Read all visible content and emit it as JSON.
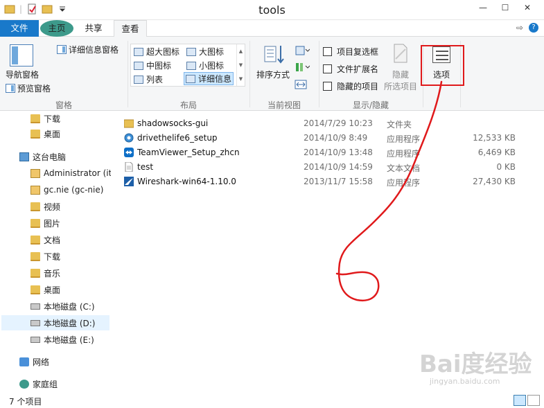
{
  "window": {
    "title": "tools"
  },
  "tabs": {
    "file": "文件",
    "home": "主页",
    "share": "共享",
    "view": "查看"
  },
  "ribbon": {
    "groups": {
      "panes": "窗格",
      "layout": "布局",
      "current_view": "当前视图",
      "show_hide": "显示/隐藏"
    },
    "nav_pane": "导航窗格",
    "preview_pane": "预览窗格",
    "details_pane": "详细信息窗格",
    "layout_items": {
      "extra_large": "超大图标",
      "large": "大图标",
      "medium": "中图标",
      "small": "小图标",
      "list": "列表",
      "details": "详细信息"
    },
    "sort_by": "排序方式",
    "item_checkboxes": "项目复选框",
    "file_extensions": "文件扩展名",
    "hidden_items": "隐藏的项目",
    "hide": "隐藏",
    "hide_selected": "所选项目",
    "options": "选项"
  },
  "navpane": {
    "items": [
      {
        "label": "下载",
        "icon": "folder-icon"
      },
      {
        "label": "桌面",
        "icon": "folder-icon"
      },
      {
        "label": "这台电脑",
        "icon": "pc-icon"
      },
      {
        "label": "Administrator (iti",
        "icon": "network-drive-icon"
      },
      {
        "label": "gc.nie (gc-nie)",
        "icon": "network-drive-icon"
      },
      {
        "label": "视频",
        "icon": "folder-icon"
      },
      {
        "label": "图片",
        "icon": "folder-icon"
      },
      {
        "label": "文档",
        "icon": "folder-icon"
      },
      {
        "label": "下载",
        "icon": "folder-icon"
      },
      {
        "label": "音乐",
        "icon": "folder-icon"
      },
      {
        "label": "桌面",
        "icon": "folder-icon"
      },
      {
        "label": "本地磁盘 (C:)",
        "icon": "drive-icon"
      },
      {
        "label": "本地磁盘 (D:)",
        "icon": "drive-icon"
      },
      {
        "label": "本地磁盘 (E:)",
        "icon": "drive-icon"
      },
      {
        "label": "网络",
        "icon": "network-icon"
      },
      {
        "label": "家庭组",
        "icon": "homegroup-icon"
      }
    ]
  },
  "files": [
    {
      "name": "shadowsocks-gui",
      "date": "2014/7/29 10:23",
      "type": "文件夹",
      "size": "",
      "icon": "folder-icon"
    },
    {
      "name": "drivethelife6_setup",
      "date": "2014/10/9 8:49",
      "type": "应用程序",
      "size": "12,533 KB",
      "icon": "setup-icon"
    },
    {
      "name": "TeamViewer_Setup_zhcn",
      "date": "2014/10/9 13:48",
      "type": "应用程序",
      "size": "6,469 KB",
      "icon": "teamviewer-icon"
    },
    {
      "name": "test",
      "date": "2014/10/9 14:59",
      "type": "文本文档",
      "size": "0 KB",
      "icon": "text-file-icon"
    },
    {
      "name": "Wireshark-win64-1.10.0",
      "date": "2013/11/7 15:58",
      "type": "应用程序",
      "size": "27,430 KB",
      "icon": "wireshark-icon"
    }
  ],
  "status": {
    "count": "7 个项目"
  },
  "watermark": {
    "text": "Bai度经验",
    "sub": "jingyan.baidu.com"
  },
  "colors": {
    "accent": "#1979ca",
    "annotation": "#e0191b"
  }
}
